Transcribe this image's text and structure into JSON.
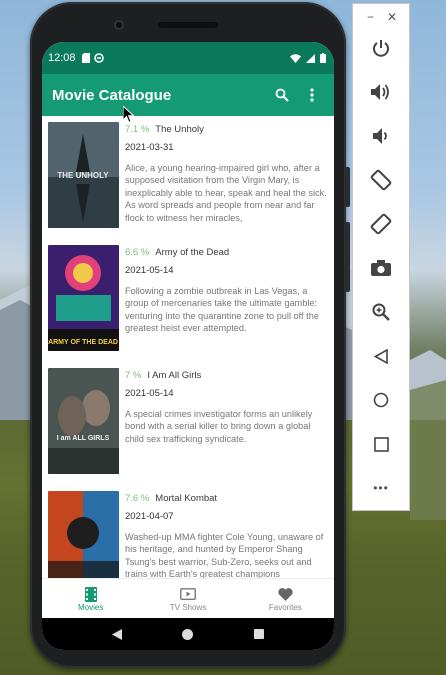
{
  "status_bar": {
    "time": "12:08"
  },
  "app_bar": {
    "title": "Movie Catalogue",
    "search_icon": "search-icon",
    "menu_icon": "more-vert-icon"
  },
  "colors": {
    "status": "#0b7a5a",
    "primary": "#149b73",
    "rating": "#7bbf7b"
  },
  "movies": [
    {
      "rating": "7.1 %",
      "title": "The Unholy",
      "date": "2021-03-31",
      "description": "Alice, a young hearing-impaired girl who, after a supposed visitation from the Virgin Mary, is inexplicably able to hear, speak and heal the sick. As word spreads and people from near and far flock to witness her miracles,",
      "poster_text": "THE UNHOLY"
    },
    {
      "rating": "6.6 %",
      "title": "Army of the Dead",
      "date": "2021-05-14",
      "description": "Following a zombie outbreak in Las Vegas, a group of mercenaries take the ultimate gamble: venturing into the quarantine zone to pull off the greatest heist ever attempted.",
      "poster_text": "ARMY OF THE DEAD"
    },
    {
      "rating": "7 %",
      "title": "I Am All Girls",
      "date": "2021-05-14",
      "description": "A special crimes investigator forms an unlikely bond with a serial killer to bring down a global child sex trafficking syndicate.",
      "poster_text": "I am ALL GIRLS"
    },
    {
      "rating": "7.6 %",
      "title": "Mortal Kombat",
      "date": "2021-04-07",
      "description": "Washed-up MMA fighter Cole Young, unaware of his heritage, and hunted by Emperor Shang Tsung's best warrior, Sub-Zero, seeks out and trains with Earth's greatest champions",
      "poster_text": ""
    }
  ],
  "bottom_nav": [
    {
      "label": "Movies",
      "icon": "film-icon",
      "active": true
    },
    {
      "label": "TV Shows",
      "icon": "tv-play-icon",
      "active": false
    },
    {
      "label": "Favorites",
      "icon": "heart-icon",
      "active": false
    }
  ],
  "emulator_toolbar": {
    "minimize": "−",
    "close": "✕",
    "buttons": [
      "power-icon",
      "volume-up-icon",
      "volume-down-icon",
      "rotate-left-icon",
      "rotate-right-icon",
      "camera-icon",
      "zoom-icon",
      "back-icon",
      "home-icon",
      "overview-icon",
      "more-icon"
    ],
    "more_label": "•••"
  }
}
